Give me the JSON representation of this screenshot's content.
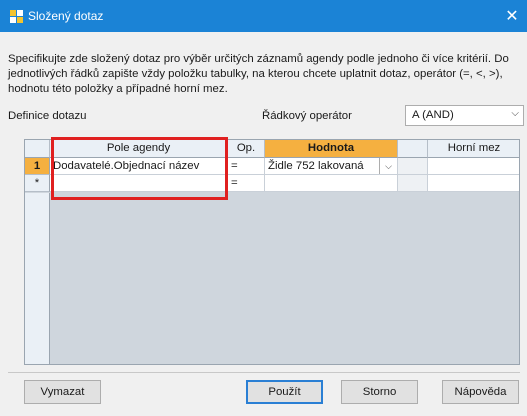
{
  "window": {
    "title": "Složený dotaz",
    "close": "✕"
  },
  "description": "Specifikujte zde složený dotaz pro výběr určitých záznamů agendy podle jednoho či více kritérií. Do jednotlivých řádků zapište vždy položku tabulky, na kterou chcete uplatnit dotaz, operátor (=, <, >), hodnotu této položky a případné horní mez.",
  "labels": {
    "definition": "Definice dotazu",
    "row_operator": "Řádkový operátor"
  },
  "row_operator_combo": {
    "value": "A (AND)",
    "arrow": "⌵"
  },
  "grid": {
    "columns": [
      "Pole agendy",
      "Op.",
      "Hodnota",
      "Horní mez"
    ],
    "rows": [
      {
        "header": "1",
        "field": "Dodavatelé.Objednací název",
        "op": "=",
        "value": "Židle 752 lakovaná",
        "upper": ""
      },
      {
        "header": "*",
        "field": "",
        "op": "=",
        "value": "",
        "upper": ""
      }
    ]
  },
  "buttons": {
    "clear": "Vymazat",
    "apply": "Použít",
    "cancel": "Storno",
    "help": "Nápověda"
  },
  "colors": {
    "titlebar": "#1b83d6",
    "active_header": "#f5b040",
    "highlight": "#e02020"
  }
}
